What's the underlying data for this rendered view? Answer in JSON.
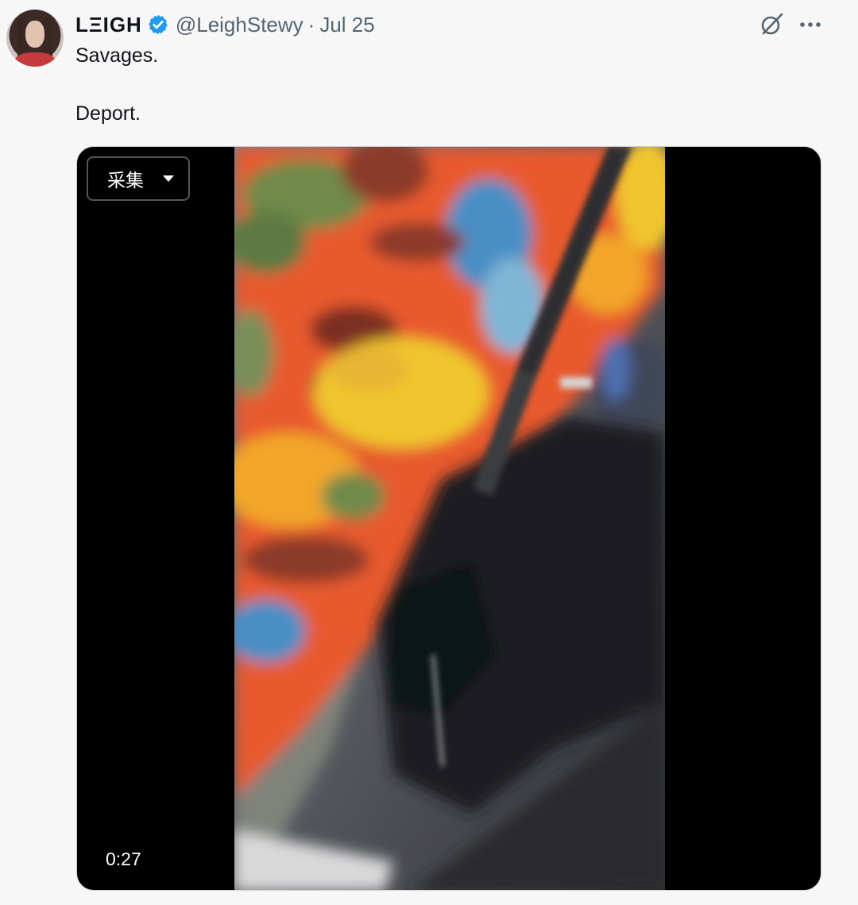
{
  "tweet": {
    "display_name": "LΞIGH",
    "handle": "@LeighStewy",
    "separator": "·",
    "date": "Jul 25",
    "text_lines": [
      "Savages.",
      "Deport."
    ]
  },
  "media": {
    "collect_button_label": "采集",
    "duration": "0:27"
  },
  "colors": {
    "verified_badge": "#1d9bf0",
    "secondary_text": "#536471",
    "video_background": "#000000"
  },
  "icons": {
    "verified": "verified-badge-icon",
    "grok": "grok-icon",
    "more": "more-icon",
    "caret": "caret-down-icon"
  }
}
